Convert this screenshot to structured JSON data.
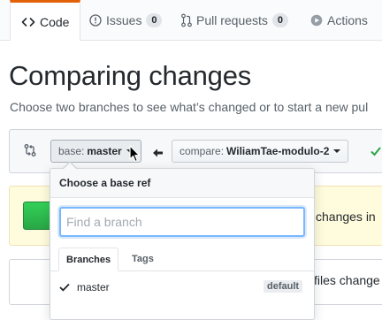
{
  "tabs": [
    {
      "label": "Code",
      "icon": "code-icon",
      "active": true
    },
    {
      "label": "Issues",
      "icon": "issue-opened-icon",
      "count": "0"
    },
    {
      "label": "Pull requests",
      "icon": "git-pull-request-icon",
      "count": "0"
    },
    {
      "label": "Actions",
      "icon": "play-icon"
    }
  ],
  "page": {
    "title": "Comparing changes",
    "subtitle": "Choose two branches to see what’s changed or to start a new pul"
  },
  "compare_bar": {
    "base_prefix": "base:",
    "base_value": "master",
    "compare_prefix": "compare:",
    "compare_value": "WiliamTae-modulo-2"
  },
  "background": {
    "yellow_text": "changes in",
    "bottom_text": "files change"
  },
  "dropdown": {
    "header": "Choose a base ref",
    "filter_placeholder": "Find a branch",
    "tabs": [
      "Branches",
      "Tags"
    ],
    "items": [
      {
        "name": "master",
        "selected": true,
        "badge": "default"
      }
    ]
  },
  "colors": {
    "accent_orange": "#e36209",
    "focus_blue": "#79b8ff",
    "success_green": "#28a745",
    "notice_yellow": "#fffbdd"
  }
}
